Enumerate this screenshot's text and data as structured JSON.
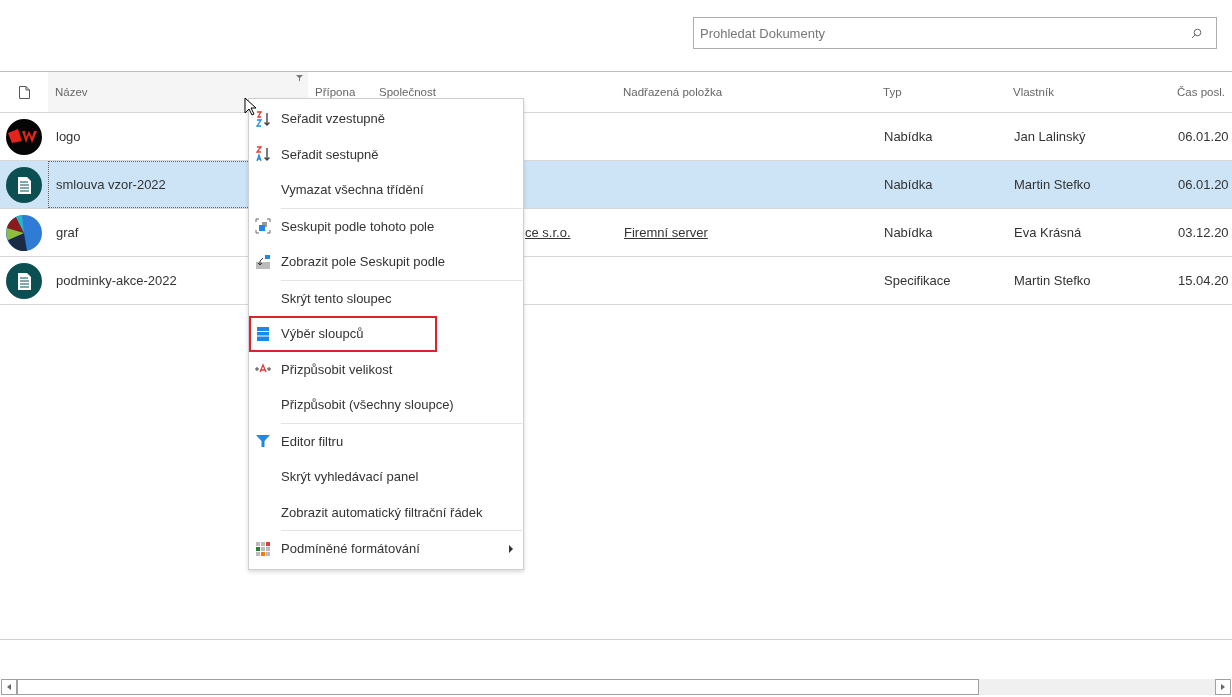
{
  "search": {
    "placeholder": "Prohledat Dokumenty"
  },
  "columns": [
    {
      "label": "Název",
      "kind": "name",
      "filter": true
    },
    {
      "label": "Přípona",
      "kind": "ext",
      "filter": false
    },
    {
      "label": "Společnost",
      "kind": "company",
      "filter": false
    },
    {
      "label": "Nadřazená položka",
      "kind": "parent",
      "filter": false
    },
    {
      "label": "Typ",
      "kind": "type",
      "filter": false
    },
    {
      "label": "Vlastník",
      "kind": "owner",
      "filter": false
    },
    {
      "label": "Čas posl.",
      "kind": "time",
      "filter": false
    }
  ],
  "rows": [
    {
      "kind": "logo",
      "name": "logo",
      "company": "",
      "parent": "",
      "type": "Nabídka",
      "owner": "Jan Lalinský",
      "time": "06.01.20",
      "selected": false
    },
    {
      "kind": "document",
      "name": "smlouva vzor-2022",
      "company": "",
      "parent": "",
      "type": "Nabídka",
      "owner": "Martin Stefko",
      "time": "06.01.20",
      "selected": true
    },
    {
      "kind": "chart",
      "name": "graf",
      "company": "ce s.r.o.",
      "parent": "Firemní server",
      "type": "Nabídka",
      "owner": "Eva Krásná",
      "time": "03.12.20",
      "selected": false
    },
    {
      "kind": "document",
      "name": "podminky-akce-2022",
      "company": "",
      "parent": "",
      "type": "Specifikace",
      "owner": "Martin Stefko",
      "time": "15.04.20",
      "selected": false
    }
  ],
  "menu": [
    {
      "label": "Seřadit vzestupně",
      "kind": "sort-asc",
      "separator_before": false,
      "highlighted": false,
      "submenu": false
    },
    {
      "label": "Seřadit sestupně",
      "kind": "sort-desc",
      "separator_before": false,
      "highlighted": false,
      "submenu": false
    },
    {
      "label": "Vymazat všechna třídění",
      "kind": "plain",
      "separator_before": false,
      "highlighted": false,
      "submenu": false
    },
    {
      "label": "Seskupit podle tohoto pole",
      "kind": "group",
      "separator_before": true,
      "highlighted": false,
      "submenu": false
    },
    {
      "label": "Zobrazit pole Seskupit podle",
      "kind": "group-panel",
      "separator_before": false,
      "highlighted": false,
      "submenu": false
    },
    {
      "label": "Skrýt tento sloupec",
      "kind": "plain",
      "separator_before": true,
      "highlighted": false,
      "submenu": false
    },
    {
      "label": "Výběr sloupců",
      "kind": "columns",
      "separator_before": false,
      "highlighted": true,
      "submenu": false
    },
    {
      "label": "Přizpůsobit velikost",
      "kind": "fit",
      "separator_before": false,
      "highlighted": false,
      "submenu": false
    },
    {
      "label": "Přizpůsobit (všechny sloupce)",
      "kind": "plain",
      "separator_before": false,
      "highlighted": false,
      "submenu": false
    },
    {
      "label": "Editor filtru",
      "kind": "filter",
      "separator_before": true,
      "highlighted": false,
      "submenu": false
    },
    {
      "label": "Skrýt vyhledávací panel",
      "kind": "plain",
      "separator_before": false,
      "highlighted": false,
      "submenu": false
    },
    {
      "label": "Zobrazit automatický filtrační řádek",
      "kind": "plain",
      "separator_before": false,
      "highlighted": false,
      "submenu": false
    },
    {
      "label": "Podmíněné formátování",
      "kind": "format",
      "separator_before": true,
      "highlighted": false,
      "submenu": true
    }
  ]
}
